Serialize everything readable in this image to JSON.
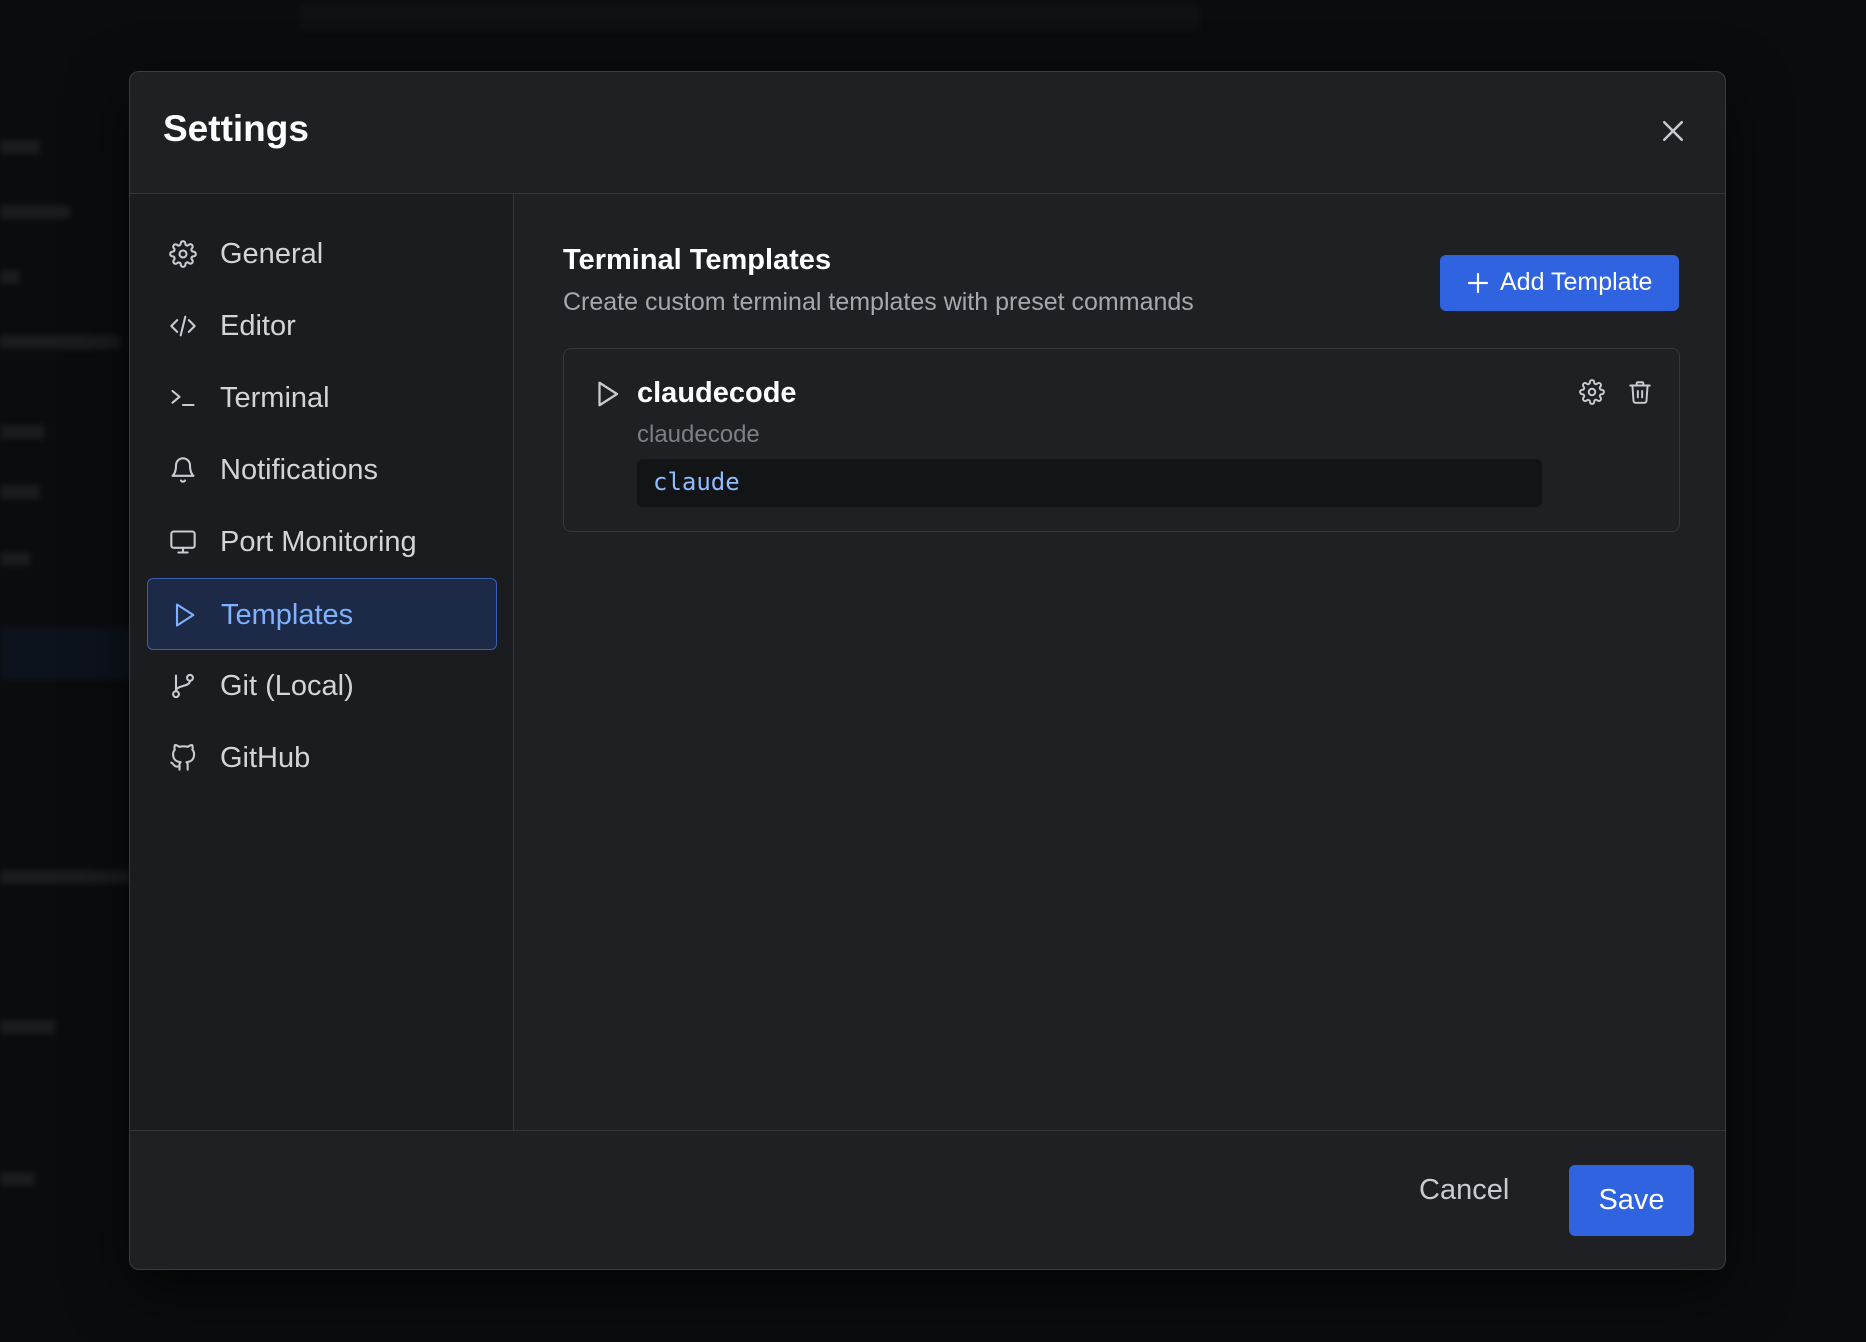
{
  "dialog": {
    "title": "Settings"
  },
  "sidebar": {
    "items": [
      {
        "label": "General",
        "icon": "gear-icon"
      },
      {
        "label": "Editor",
        "icon": "code-icon"
      },
      {
        "label": "Terminal",
        "icon": "terminal-icon"
      },
      {
        "label": "Notifications",
        "icon": "bell-icon"
      },
      {
        "label": "Port Monitoring",
        "icon": "monitor-icon"
      },
      {
        "label": "Templates",
        "icon": "play-icon",
        "active": true
      },
      {
        "label": "Git (Local)",
        "icon": "git-branch-icon"
      },
      {
        "label": "GitHub",
        "icon": "github-icon"
      }
    ]
  },
  "main": {
    "title": "Terminal Templates",
    "description": "Create custom terminal templates with preset commands",
    "add_button_label": "Add Template",
    "templates": [
      {
        "name": "claudecode",
        "subtitle": "claudecode",
        "command": "claude"
      }
    ]
  },
  "footer": {
    "cancel_label": "Cancel",
    "save_label": "Save"
  },
  "colors": {
    "accent": "#2f63e0",
    "active_text": "#7fb1ff",
    "modal_bg": "#1f2023"
  }
}
